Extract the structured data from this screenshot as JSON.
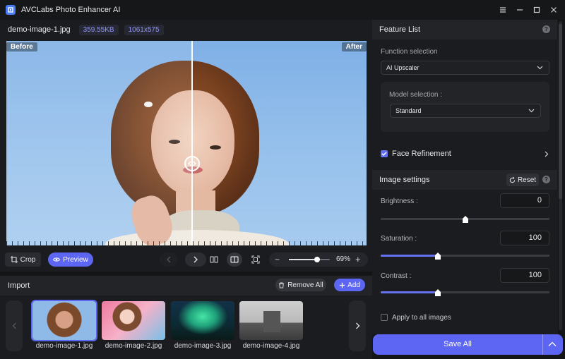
{
  "app": {
    "title": "AVCLabs Photo Enhancer AI"
  },
  "file": {
    "name": "demo-image-1.jpg",
    "size": "359.55KB",
    "dimensions": "1061x575"
  },
  "viewer": {
    "before_label": "Before",
    "after_label": "After"
  },
  "toolbar": {
    "crop_label": "Crop",
    "preview_label": "Preview",
    "zoom": {
      "value": 0.69,
      "label": "69%"
    }
  },
  "import": {
    "title": "Import",
    "remove_all_label": "Remove All",
    "add_label": "Add",
    "items": [
      {
        "name": "demo-image-1.jpg",
        "selected": true
      },
      {
        "name": "demo-image-2.jpg",
        "selected": false
      },
      {
        "name": "demo-image-3.jpg",
        "selected": false
      },
      {
        "name": "demo-image-4.jpg",
        "selected": false
      }
    ]
  },
  "feature_list": {
    "title": "Feature List",
    "function_selection_label": "Function selection",
    "function_selected": "AI Upscaler",
    "model_selection_label": "Model selection :",
    "model_selected": "Standard",
    "face_refinement_label": "Face Refinement",
    "face_refinement_checked": true
  },
  "image_settings": {
    "title": "Image settings",
    "reset_label": "Reset",
    "brightness": {
      "label": "Brightness :",
      "value": "0",
      "slider": 0.5
    },
    "saturation": {
      "label": "Saturation :",
      "value": "100",
      "slider": 0.34
    },
    "contrast": {
      "label": "Contrast :",
      "value": "100",
      "slider": 0.34
    },
    "apply_all_label": "Apply to all images",
    "apply_all_checked": false
  },
  "save": {
    "label": "Save All"
  },
  "colors": {
    "accent": "#5d66f2",
    "background": "#141517",
    "panel": "#1b1c1f",
    "chip_text": "#8f93f7"
  }
}
